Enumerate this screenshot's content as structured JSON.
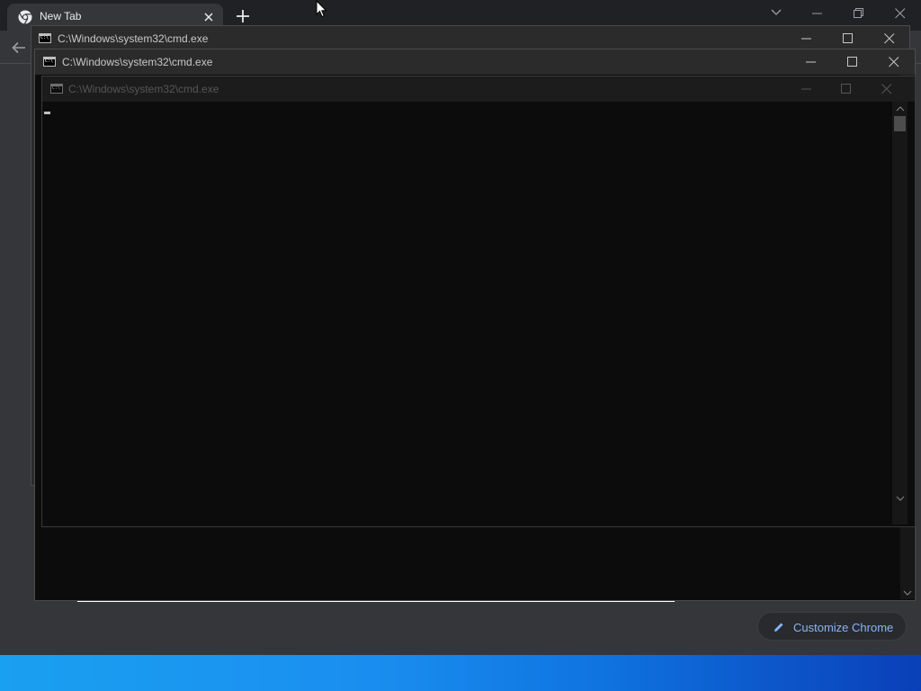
{
  "chrome": {
    "tab": {
      "title": "New Tab",
      "favicon": "chrome-icon"
    },
    "customize_label": "Customize Chrome"
  },
  "cmd_windows": [
    {
      "title": "C:\\Windows\\system32\\cmd.exe",
      "state": "background"
    },
    {
      "title": "C:\\Windows\\system32\\cmd.exe",
      "state": "background"
    },
    {
      "title": "C:\\Windows\\system32\\cmd.exe",
      "state": "active-dimmed"
    }
  ],
  "colors": {
    "chrome_bg": "#35363a",
    "tabstrip_bg": "#202124",
    "console_bg": "#0c0c0c",
    "accent": "#8ab4f8",
    "taskbar": "#1a8ef0"
  }
}
